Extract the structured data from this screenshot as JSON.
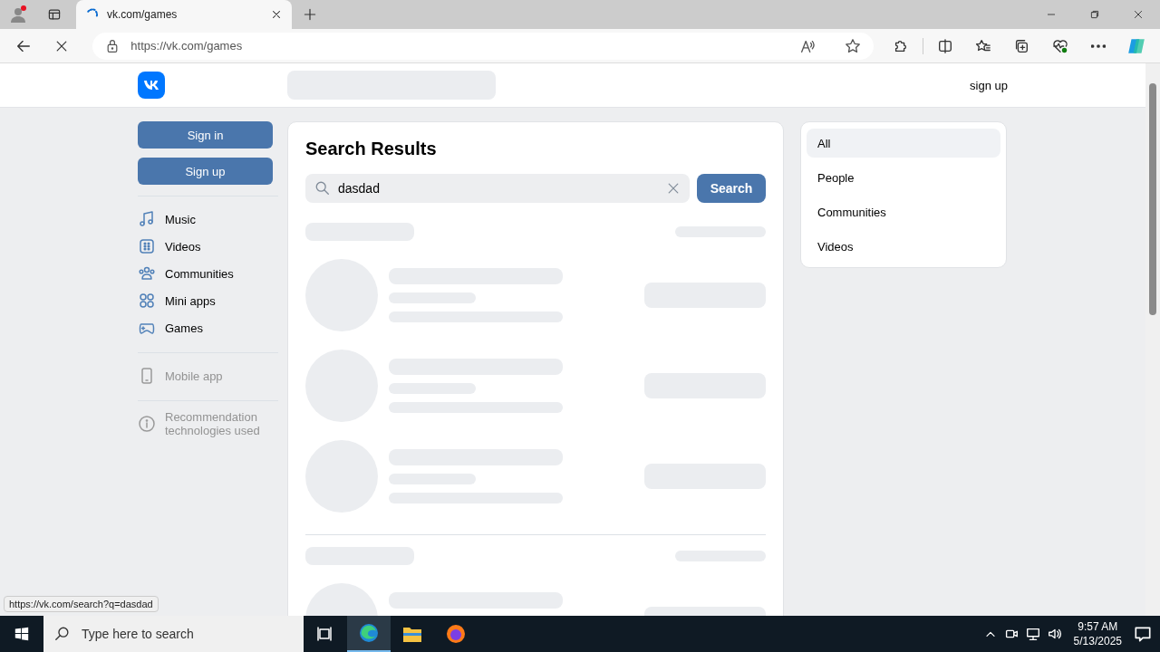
{
  "browser": {
    "tabs": [
      {
        "title": "vk.com/games",
        "selected": true
      }
    ],
    "address": "https://vk.com/games"
  },
  "header": {
    "signup_link": "sign up"
  },
  "sidebar": {
    "buttons": [
      "Sign in",
      "Sign up"
    ],
    "items": [
      {
        "label": "Music"
      },
      {
        "label": "Videos"
      },
      {
        "label": "Communities"
      },
      {
        "label": "Mini apps"
      },
      {
        "label": "Games"
      }
    ],
    "footer_items": [
      {
        "label": "Mobile app"
      },
      {
        "label": "Recommendation technologies used"
      }
    ]
  },
  "search": {
    "title": "Search Results",
    "query": "dasdad",
    "button": "Search"
  },
  "filters": [
    {
      "label": "All",
      "selected": true
    },
    {
      "label": "People",
      "selected": false
    },
    {
      "label": "Communities",
      "selected": false
    },
    {
      "label": "Videos",
      "selected": false
    }
  ],
  "status_url": "https://vk.com/search?q=dasdad",
  "taskbar": {
    "search_placeholder": "Type here to search",
    "time": "9:57 AM",
    "date": "5/13/2025"
  }
}
